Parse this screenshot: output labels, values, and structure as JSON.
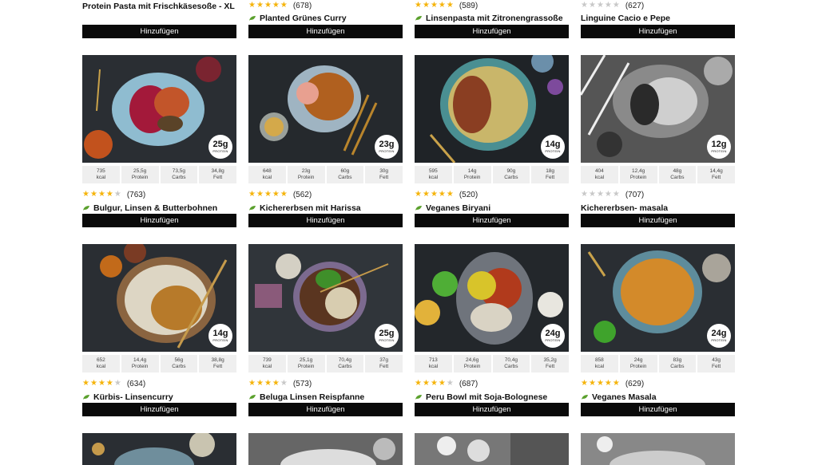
{
  "rows": [
    {
      "cards": [
        {
          "title": "Protein Pasta mit Frischkäsesoße - XL",
          "leaf": false,
          "rating": null,
          "stars": 0,
          "button": "Hinzufügen"
        },
        {
          "title": "Planted Grünes Curry",
          "leaf": true,
          "rating": "(678)",
          "stars": 4.5,
          "button": "Hinzufügen"
        },
        {
          "title": "Linsenpasta mit Zitronengrassoße",
          "leaf": true,
          "rating": "(589)",
          "stars": 4.5,
          "button": "Hinzufügen"
        },
        {
          "title": "Linguine Cacio e Pepe",
          "leaf": false,
          "rating": "(627)",
          "stars": 4.5,
          "gray": true,
          "button": "Hinzufügen"
        }
      ]
    },
    {
      "cards": [
        {
          "protein_badge": "25g",
          "badge_sub": "PROTEIN",
          "nutrition": [
            [
              "735",
              "kcal"
            ],
            [
              "25,5g",
              "Protein"
            ],
            [
              "73,5g",
              "Carbs"
            ],
            [
              "34,8g",
              "Fett"
            ]
          ],
          "rating": "(763)",
          "stars": 4,
          "title": "Bulgur, Linsen & Butterbohnen",
          "leaf": true,
          "button": "Hinzufügen"
        },
        {
          "protein_badge": "23g",
          "badge_sub": "PROTEIN",
          "nutrition": [
            [
              "648",
              "kcal"
            ],
            [
              "23g",
              "Protein"
            ],
            [
              "60g",
              "Carbs"
            ],
            [
              "30g",
              "Fett"
            ]
          ],
          "rating": "(562)",
          "stars": 4.5,
          "title": "Kichererbsen mit Harissa",
          "leaf": true,
          "button": "Hinzufügen"
        },
        {
          "protein_badge": "14g",
          "badge_sub": "PROTEIN",
          "nutrition": [
            [
              "595",
              "kcal"
            ],
            [
              "14g",
              "Protein"
            ],
            [
              "90g",
              "Carbs"
            ],
            [
              "18g",
              "Fett"
            ]
          ],
          "rating": "(520)",
          "stars": 5,
          "title": "Veganes Biryani",
          "leaf": true,
          "button": "Hinzufügen"
        },
        {
          "protein_badge": "12g",
          "badge_sub": "PROTEIN",
          "nutrition": [
            [
              "404",
              "kcal"
            ],
            [
              "12,4g",
              "Protein"
            ],
            [
              "48g",
              "Carbs"
            ],
            [
              "14,4g",
              "Fett"
            ]
          ],
          "rating": "(707)",
          "stars": 4.5,
          "gray": true,
          "title": "Kichererbsen- masala",
          "leaf": false,
          "button": "Hinzufügen"
        }
      ]
    },
    {
      "cards": [
        {
          "protein_badge": "14g",
          "badge_sub": "PROTEIN",
          "nutrition": [
            [
              "652",
              "kcal"
            ],
            [
              "14,4g",
              "Protein"
            ],
            [
              "56g",
              "Carbs"
            ],
            [
              "38,8g",
              "Fett"
            ]
          ],
          "rating": "(634)",
          "stars": 4,
          "title": "Kürbis- Linsencurry",
          "leaf": true,
          "button": "Hinzufügen"
        },
        {
          "protein_badge": "25g",
          "badge_sub": "PROTEIN",
          "nutrition": [
            [
              "739",
              "kcal"
            ],
            [
              "25,1g",
              "Protein"
            ],
            [
              "70,4g",
              "Carbs"
            ],
            [
              "37g",
              "Fett"
            ]
          ],
          "rating": "(573)",
          "stars": 4,
          "title": "Beluga Linsen Reispfanne",
          "leaf": true,
          "button": "Hinzufügen"
        },
        {
          "protein_badge": "24g",
          "badge_sub": "PROTEIN",
          "nutrition": [
            [
              "713",
              "kcal"
            ],
            [
              "24,6g",
              "Protein"
            ],
            [
              "70,4g",
              "Carbs"
            ],
            [
              "35,2g",
              "Fett"
            ]
          ],
          "rating": "(687)",
          "stars": 4,
          "title": "Peru Bowl mit Soja-Bolognese",
          "leaf": true,
          "button": "Hinzufügen"
        },
        {
          "protein_badge": "24g",
          "badge_sub": "PROTEIN",
          "nutrition": [
            [
              "858",
              "kcal"
            ],
            [
              "24g",
              "Protein"
            ],
            [
              "83g",
              "Carbs"
            ],
            [
              "43g",
              "Fett"
            ]
          ],
          "rating": "(629)",
          "stars": 5,
          "title": "Veganes Masala",
          "leaf": true,
          "button": "Hinzufügen"
        }
      ]
    }
  ],
  "colors": {
    "star": "#f5b40c",
    "button_bg": "#0a0a0a",
    "leaf": "#5aa02c",
    "nutrition_bg": "#efefef"
  }
}
